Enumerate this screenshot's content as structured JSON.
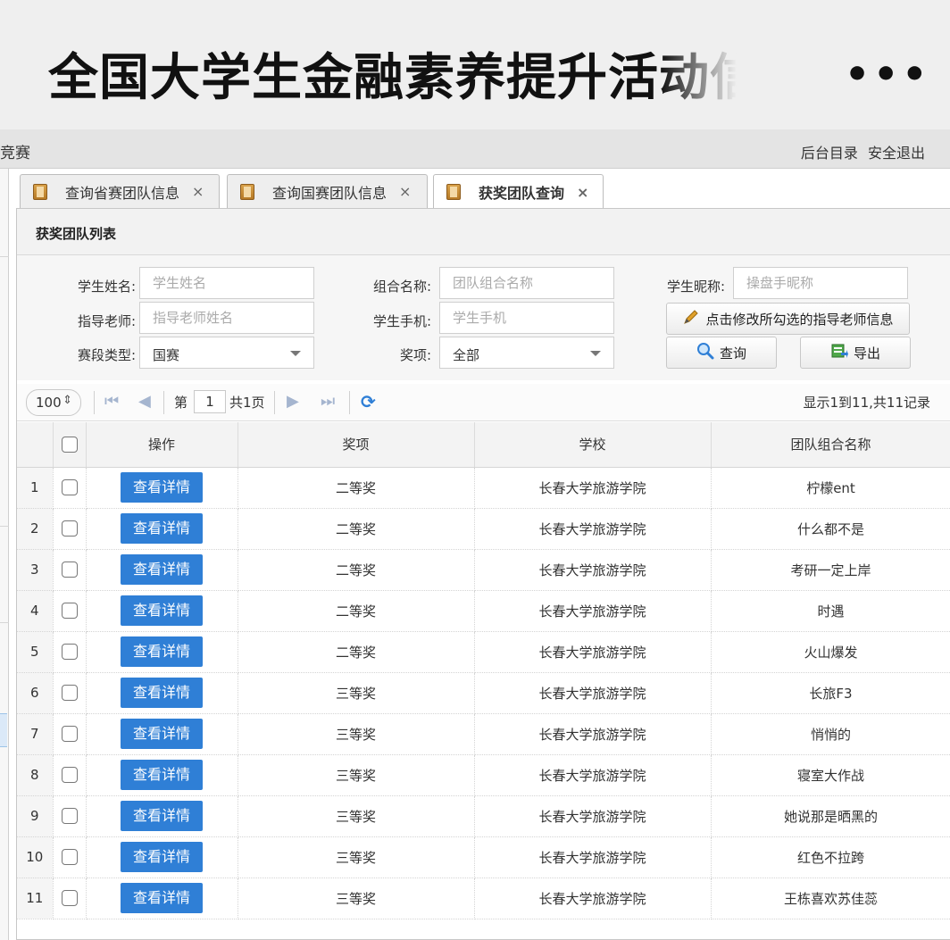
{
  "topbar": {
    "title": "全国大学生金融素养提升活动信",
    "more_icon": "•••"
  },
  "header": {
    "app_name": "竞赛",
    "backend_link": "后台目录",
    "logout_link": "安全退出"
  },
  "tabs": [
    {
      "label": "查询省赛团队信息",
      "close": "×",
      "active": false
    },
    {
      "label": "查询国赛团队信息",
      "close": "×",
      "active": false
    },
    {
      "label": "获奖团队查询",
      "close": "×",
      "active": true
    }
  ],
  "panel": {
    "title": "获奖团队列表"
  },
  "form": {
    "student_name": {
      "label": "学生姓名:",
      "placeholder": "学生姓名"
    },
    "group_name": {
      "label": "组合名称:",
      "placeholder": "团队组合名称"
    },
    "nickname": {
      "label": "学生昵称:",
      "placeholder": "操盘手昵称"
    },
    "teacher": {
      "label": "指导老师:",
      "placeholder": "指导老师姓名"
    },
    "phone": {
      "label": "学生手机:",
      "placeholder": "学生手机"
    },
    "stage_type": {
      "label": "赛段类型:",
      "value": "国赛"
    },
    "award": {
      "label": "奖项:",
      "value": "全部"
    },
    "edit_teacher_button": "点击修改所勾选的指导老师信息",
    "query_button": "查询",
    "export_button": "导出"
  },
  "pager": {
    "page_size": "100",
    "page_prefix": "第",
    "current_page": "1",
    "page_total": "共1页",
    "info": "显示1到11,共11记录"
  },
  "table": {
    "columns": [
      "操作",
      "奖项",
      "学校",
      "团队组合名称"
    ],
    "detail_label": "查看详情",
    "rows": [
      {
        "no": "1",
        "award": "二等奖",
        "school": "长春大学旅游学院",
        "team": "柠檬ent"
      },
      {
        "no": "2",
        "award": "二等奖",
        "school": "长春大学旅游学院",
        "team": "什么都不是"
      },
      {
        "no": "3",
        "award": "二等奖",
        "school": "长春大学旅游学院",
        "team": "考研一定上岸"
      },
      {
        "no": "4",
        "award": "二等奖",
        "school": "长春大学旅游学院",
        "team": "时遇"
      },
      {
        "no": "5",
        "award": "二等奖",
        "school": "长春大学旅游学院",
        "team": "火山爆发"
      },
      {
        "no": "6",
        "award": "三等奖",
        "school": "长春大学旅游学院",
        "team": "长旅F3"
      },
      {
        "no": "7",
        "award": "三等奖",
        "school": "长春大学旅游学院",
        "team": "悄悄的"
      },
      {
        "no": "8",
        "award": "三等奖",
        "school": "长春大学旅游学院",
        "team": "寝室大作战"
      },
      {
        "no": "9",
        "award": "三等奖",
        "school": "长春大学旅游学院",
        "team": "她说那是晒黑的"
      },
      {
        "no": "10",
        "award": "三等奖",
        "school": "长春大学旅游学院",
        "team": "红色不拉跨"
      },
      {
        "no": "11",
        "award": "三等奖",
        "school": "长春大学旅游学院",
        "team": "王栋喜欢苏佳蕊"
      }
    ]
  },
  "colors": {
    "accent": "#2f7fd6",
    "header_bg": "#e4e4e4",
    "topbar_bg": "#efefef"
  }
}
